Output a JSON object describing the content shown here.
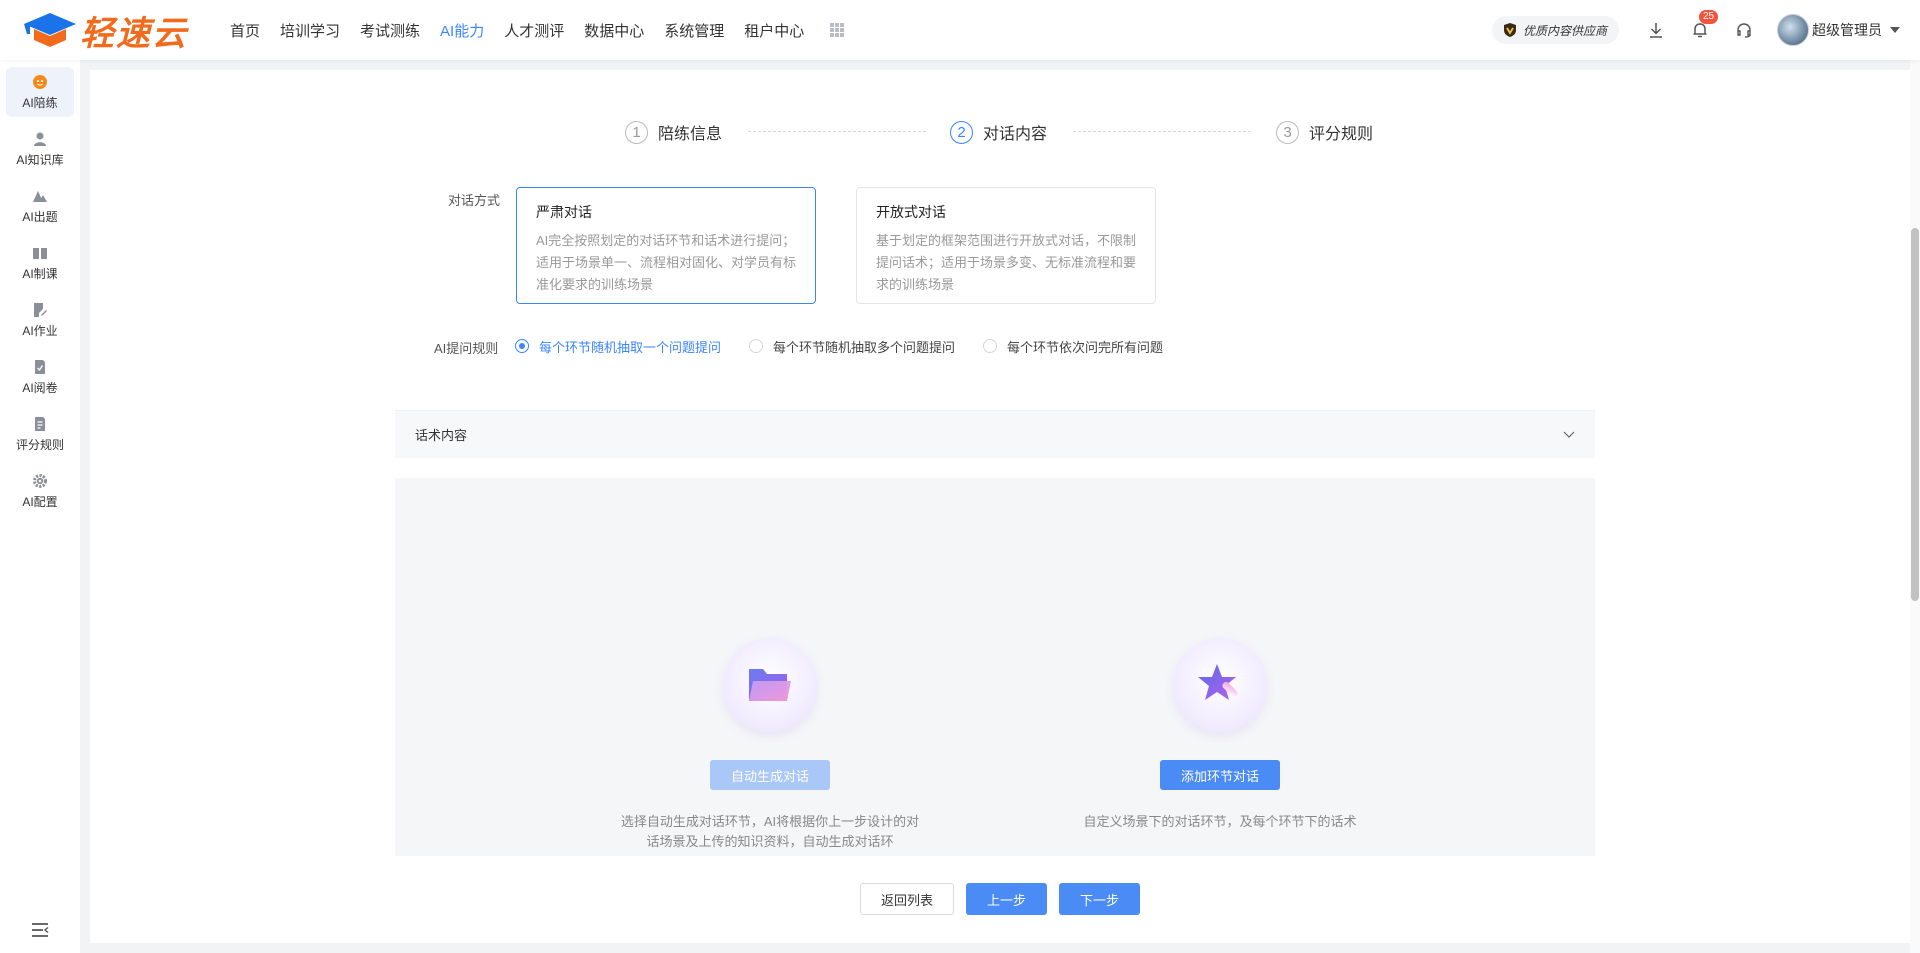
{
  "brand": {
    "name": "轻速云",
    "accent": "#f26b1d",
    "mark_color": "#1a73e8"
  },
  "nav": {
    "items": [
      "首页",
      "培训学习",
      "考试测练",
      "AI能力",
      "人才测评",
      "数据中心",
      "系统管理",
      "租户中心"
    ],
    "active": "AI能力",
    "grid_icon": "apps-grid-icon"
  },
  "header": {
    "supplier_label": "优质内容供应商",
    "notification_count": "25",
    "user_name": "超级管理员",
    "icons": [
      "download-icon",
      "bell-icon",
      "headset-icon",
      "chevron-down-icon"
    ]
  },
  "sidebar": {
    "items": [
      {
        "label": "AI陪练",
        "icon": "ai-coach-icon",
        "active": true
      },
      {
        "label": "AI知识库",
        "icon": "person-icon"
      },
      {
        "label": "AI出题",
        "icon": "triangles-icon"
      },
      {
        "label": "AI制课",
        "icon": "book-icon"
      },
      {
        "label": "AI作业",
        "icon": "edit-doc-icon"
      },
      {
        "label": "AI阅卷",
        "icon": "doc-check-icon"
      },
      {
        "label": "评分规则",
        "icon": "doc-rule-icon"
      },
      {
        "label": "AI配置",
        "icon": "gear-icon"
      }
    ],
    "collapse_icon": "menu-collapse-icon"
  },
  "steps": [
    {
      "num": "1",
      "title": "陪练信息"
    },
    {
      "num": "2",
      "title": "对话内容",
      "active": true
    },
    {
      "num": "3",
      "title": "评分规则"
    }
  ],
  "dialog_mode": {
    "label": "对话方式",
    "options": [
      {
        "title": "严肃对话",
        "desc": "AI完全按照划定的对话环节和话术进行提问；适用于场景单一、流程相对固化、对学员有标准化要求的训练场景",
        "selected": true
      },
      {
        "title": "开放式对话",
        "desc": "基于划定的框架范围进行开放式对话，不限制提问话术；适用于场景多变、无标准流程和要求的训练场景"
      }
    ]
  },
  "question_rule": {
    "label": "AI提问规则",
    "options": [
      "每个环节随机抽取一个问题提问",
      "每个环节随机抽取多个问题提问",
      "每个环节依次问完所有问题"
    ],
    "selected_index": 0
  },
  "script_section": {
    "title": "话术内容"
  },
  "content_options": [
    {
      "button": "自动生成对话",
      "desc": "选择自动生成对话环节，AI将根据你上一步设计的对话场景及上传的知识资料，自动生成对话环",
      "disabled": true,
      "icon": "folder-icon"
    },
    {
      "button": "添加环节对话",
      "desc": "自定义场景下的对话环节，及每个环节下的话术",
      "icon": "magic-star-icon"
    }
  ],
  "footer": {
    "back": "返回列表",
    "prev": "上一步",
    "next": "下一步"
  },
  "colors": {
    "primary": "#3a86ff",
    "button_primary": "#4b8bf5",
    "button_disabled": "#a9c7f7"
  }
}
